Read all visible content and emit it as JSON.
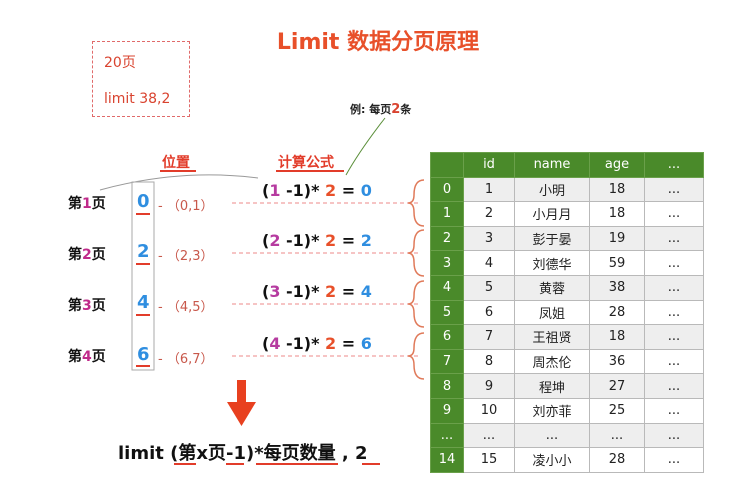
{
  "title": "Limit 数据分页原理",
  "note": {
    "line1": "20页",
    "line2": "limit 38,2"
  },
  "example_note": {
    "prefix": "例: 每页",
    "number": "2",
    "suffix": "条"
  },
  "headers": {
    "position": "位置",
    "formula": "计算公式"
  },
  "pages": [
    {
      "pre": "第",
      "num": "1",
      "post": "页",
      "offset": "0",
      "range": "- （0,1）",
      "expr_open": "(",
      "expr_page": "1",
      "expr_mid": " -1)* ",
      "expr_mult": "2",
      "expr_eq": " = ",
      "expr_result": "0"
    },
    {
      "pre": "第",
      "num": "2",
      "post": "页",
      "offset": "2",
      "range": "- （2,3）",
      "expr_open": "(",
      "expr_page": "2",
      "expr_mid": " -1)* ",
      "expr_mult": "2",
      "expr_eq": " = ",
      "expr_result": "2"
    },
    {
      "pre": "第",
      "num": "3",
      "post": "页",
      "offset": "4",
      "range": "- （4,5）",
      "expr_open": "(",
      "expr_page": "3",
      "expr_mid": " -1)* ",
      "expr_mult": "2",
      "expr_eq": " = ",
      "expr_result": "4"
    },
    {
      "pre": "第",
      "num": "4",
      "post": "页",
      "offset": "6",
      "range": "- （6,7）",
      "expr_open": "(",
      "expr_page": "4",
      "expr_mid": " -1)* ",
      "expr_mult": "2",
      "expr_eq": " = ",
      "expr_result": "6"
    }
  ],
  "bottom_formula": "limit  (第x页-1)*每页数量 , 2",
  "table": {
    "columns": [
      "",
      "id",
      "name",
      "age",
      "..."
    ],
    "rows": [
      [
        "0",
        "1",
        "小明",
        "18",
        "..."
      ],
      [
        "1",
        "2",
        "小月月",
        "18",
        "..."
      ],
      [
        "2",
        "3",
        "彭于晏",
        "19",
        "..."
      ],
      [
        "3",
        "4",
        "刘德华",
        "59",
        "..."
      ],
      [
        "4",
        "5",
        "黄蓉",
        "38",
        "..."
      ],
      [
        "5",
        "6",
        "凤姐",
        "28",
        "..."
      ],
      [
        "6",
        "7",
        "王祖贤",
        "18",
        "..."
      ],
      [
        "7",
        "8",
        "周杰伦",
        "36",
        "..."
      ],
      [
        "8",
        "9",
        "程坤",
        "27",
        "..."
      ],
      [
        "9",
        "10",
        "刘亦菲",
        "25",
        "..."
      ],
      [
        "...",
        "...",
        "...",
        "...",
        "..."
      ],
      [
        "14",
        "15",
        "凌小小",
        "28",
        "..."
      ]
    ]
  }
}
